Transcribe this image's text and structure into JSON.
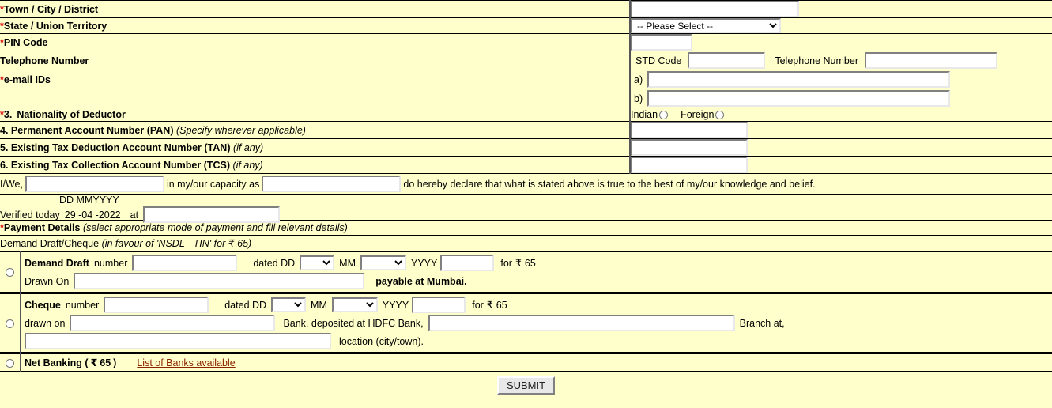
{
  "form": {
    "rows": [
      {
        "label": "Town / City / District",
        "asterisk": "*"
      },
      {
        "label": "State / Union Territory",
        "asterisk": "*"
      },
      {
        "label": "PIN Code",
        "asterisk": "*"
      },
      {
        "label": "Telephone Number",
        "asterisk": ""
      },
      {
        "label": "e-mail IDs",
        "asterisk": "*"
      }
    ],
    "state_select_value": "-- Please Select --",
    "std_code_label": "STD Code",
    "telephone_number_label": "Telephone Number",
    "email_a_label": "a)",
    "email_b_label": "b)",
    "nationality": {
      "number": "3.",
      "label": "Nationality of Deductor",
      "asterisk": "*",
      "option_indian": "Indian",
      "option_foreign": "Foreign"
    },
    "pan": {
      "number": "4.",
      "label": "Permanent Account Number (PAN)",
      "note": "(Specify wherever applicable)"
    },
    "tan": {
      "number": "5.",
      "label": "Existing Tax Deduction Account Number (TAN)",
      "note": "(if any)"
    },
    "tcs": {
      "number": "6.",
      "label": "Existing Tax Collection Account Number (TCS)",
      "note": "(if any)"
    },
    "declaration": {
      "prefix": "I/We,",
      "middle": "in my/our capacity as",
      "suffix": "do hereby declare that what is stated above is true to the best of my/our knowledge and belief.",
      "name_value": "",
      "capacity_value": ""
    },
    "verification": {
      "date_header": "DD MMYYYY",
      "prefix": "Verified today",
      "date_value": "29 -04 -2022",
      "at_label": "at",
      "place_value": ""
    }
  },
  "payment": {
    "heading": "Payment Details",
    "heading_asterisk": "*",
    "heading_note": "(select appropriate mode of payment and fill relevant details)",
    "dd_cheque_title": "Demand Draft/Cheque",
    "dd_cheque_note_pre": "(in favour of 'NSDL - TIN' for ",
    "dd_cheque_note_amount": "65)",
    "rupee_symbol": "₹",
    "demand_draft": {
      "title": "Demand Draft",
      "number_label": "number",
      "number_value": "",
      "dated_label": "dated DD",
      "dd_value": "",
      "mm_label": "MM",
      "mm_value": "",
      "yyyy_label": "YYYY",
      "yyyy_value": "",
      "for_label": "for",
      "amount": "65",
      "drawn_on_label": "Drawn On",
      "drawn_on_value": "",
      "payable_label": "payable at Mumbai."
    },
    "cheque": {
      "title": "Cheque",
      "number_label": "number",
      "number_value": "",
      "dated_label": "dated DD",
      "dd_value": "",
      "mm_label": "MM",
      "mm_value": "",
      "yyyy_label": "YYYY",
      "yyyy_value": "",
      "for_label": "for",
      "amount": "65",
      "drawn_on_label": "drawn on",
      "drawn_on_value": "",
      "bank_deposit_label": "Bank, deposited at HDFC Bank,",
      "branch_value": "",
      "branch_label": "Branch at,",
      "location_value": "",
      "location_label": "location (city/town)."
    },
    "net_banking": {
      "label_pre": "Net Banking (",
      "amount": "65",
      "label_post": ")",
      "link": "List of Banks available"
    }
  },
  "submit_label": "SUBMIT"
}
